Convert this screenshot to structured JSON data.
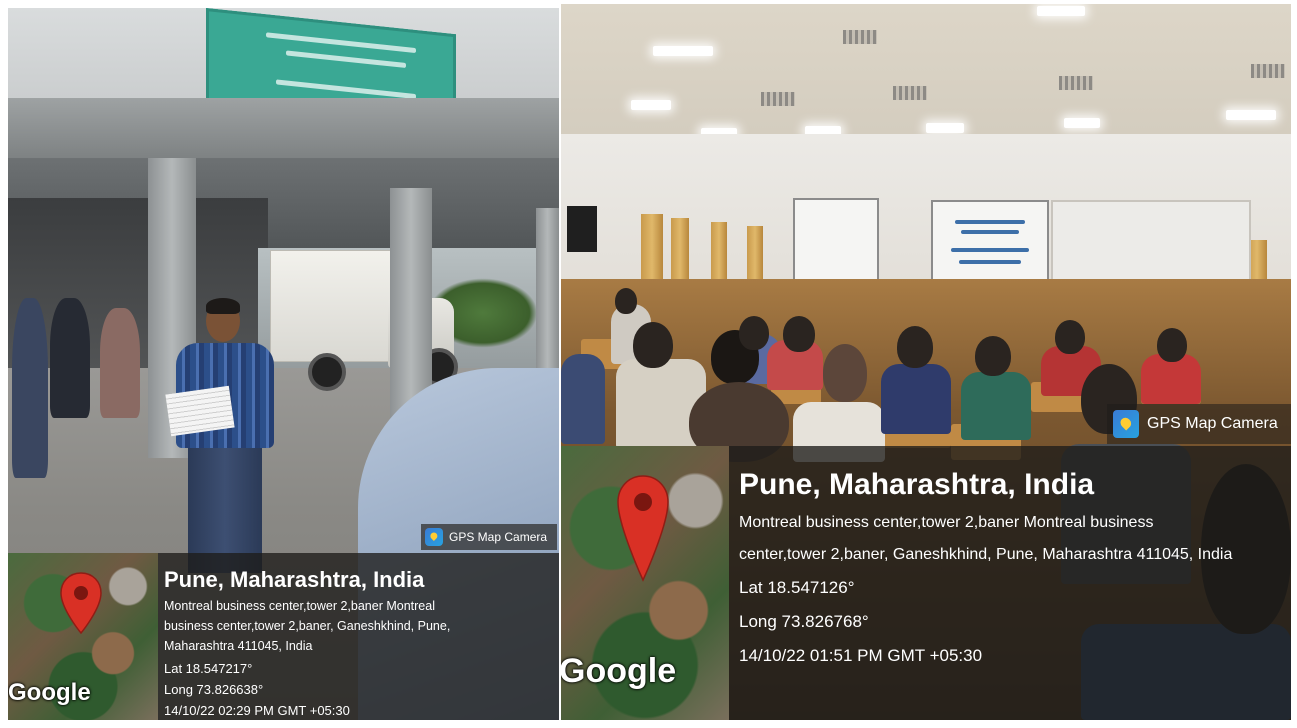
{
  "left_photo": {
    "badge_label": "GPS Map Camera",
    "map_brand": "Google",
    "location_title": "Pune, Maharashtra, India",
    "address_lines": [
      "Montreal business center,tower 2,baner Montreal",
      "business center,tower 2,baner, Ganeshkhind, Pune,",
      "Maharashtra 411045, India"
    ],
    "latitude": "Lat 18.547217°",
    "longitude": "Long 73.826638°",
    "timestamp": "14/10/22 02:29 PM GMT +05:30"
  },
  "right_photo": {
    "badge_label": "GPS Map Camera",
    "map_brand": "Google",
    "location_title": "Pune, Maharashtra, India",
    "address_lines": [
      "Montreal business center,tower 2,baner Montreal business",
      "center,tower 2,baner, Ganeshkhind, Pune, Maharashtra 411045, India"
    ],
    "latitude": "Lat 18.547126°",
    "longitude": "Long 73.826768°",
    "timestamp": "14/10/22 01:51 PM GMT +05:30"
  },
  "colors": {
    "pin": "#d93025",
    "overlay": "#1e1c1a"
  },
  "icons": [
    "map-pin-icon",
    "gps-map-camera-icon"
  ]
}
